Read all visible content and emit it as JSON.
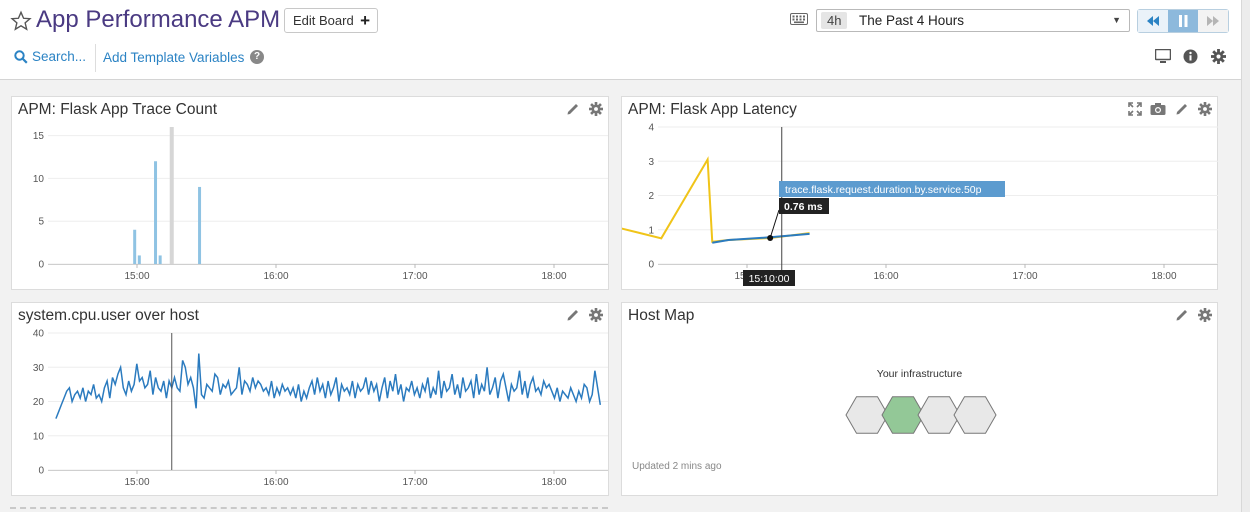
{
  "header": {
    "title": "App Performance APM",
    "edit_board_label": "Edit Board",
    "search_label": "Search...",
    "template_vars_label": "Add Template Variables",
    "time_badge": "4h",
    "time_range_label": "The Past 4 Hours"
  },
  "widgets": {
    "trace_count": {
      "title": "APM: Flask App Trace Count",
      "chart_data": {
        "type": "bar",
        "title": "APM: Flask App Trace Count",
        "x_ticks": [
          "15:00",
          "16:00",
          "17:00",
          "18:00"
        ],
        "y_ticks": [
          "0",
          "5",
          "10",
          "15"
        ],
        "ylim": [
          0,
          16
        ],
        "bar_color": "#8fc3e3",
        "bars": [
          {
            "t": "14:59",
            "value": 4
          },
          {
            "t": "15:01",
            "value": 1
          },
          {
            "t": "15:08",
            "value": 12
          },
          {
            "t": "15:10",
            "value": 1
          },
          {
            "t": "15:27",
            "value": 9
          }
        ],
        "cursor_time": "15:15"
      }
    },
    "latency": {
      "title": "APM: Flask App Latency",
      "tooltip_series": "trace.flask.request.duration.by.service.50p",
      "tooltip_value": "0.76 ms",
      "tooltip_time": "15:10:00",
      "chart_data": {
        "type": "line",
        "title": "APM: Flask App Latency",
        "x_ticks": [
          "15:00",
          "16:00",
          "17:00",
          "18:00"
        ],
        "y_ticks": [
          "0",
          "1",
          "2",
          "3",
          "4"
        ],
        "ylim": [
          0,
          4
        ],
        "series": [
          {
            "name": "trace.flask.request.duration.by.service.50p",
            "color": "#f0c419",
            "points": [
              [
                "14:05",
                1.05
              ],
              [
                "14:23",
                0.75
              ],
              [
                "14:43",
                3.05
              ],
              [
                "14:45",
                0.65
              ],
              [
                "14:52",
                0.7
              ],
              [
                "15:10",
                0.76
              ],
              [
                "15:27",
                0.9
              ]
            ]
          },
          {
            "color": "#2b7bbf",
            "points": [
              [
                "14:45",
                0.62
              ],
              [
                "14:52",
                0.7
              ],
              [
                "15:10",
                0.78
              ],
              [
                "15:27",
                0.88
              ]
            ]
          }
        ],
        "cursor_time": "15:15",
        "marker": {
          "t": "15:10",
          "value": 0.76
        }
      }
    },
    "cpu": {
      "title": "system.cpu.user over host",
      "chart_data": {
        "type": "line",
        "title": "system.cpu.user over host",
        "x_ticks": [
          "15:00",
          "16:00",
          "17:00",
          "18:00"
        ],
        "y_ticks": [
          "0",
          "10",
          "20",
          "30",
          "40"
        ],
        "ylim": [
          0,
          40
        ],
        "color": "#2b7bbf",
        "t_start": "14:25",
        "t_end": "18:20",
        "values": [
          15,
          17,
          19,
          21,
          23,
          24,
          20,
          22,
          23,
          21,
          24,
          20,
          23,
          22,
          25,
          21,
          22,
          20,
          24,
          26,
          21,
          27,
          25,
          28,
          30,
          24,
          22,
          26,
          23,
          25,
          31,
          26,
          27,
          24,
          25,
          29,
          22,
          27,
          24,
          23,
          26,
          21,
          26,
          24,
          27,
          24,
          23,
          32,
          30,
          25,
          27,
          24,
          18,
          34,
          22,
          21,
          25,
          24,
          23,
          28,
          27,
          22,
          25,
          24,
          26,
          22,
          23,
          24,
          30,
          22,
          26,
          25,
          23,
          27,
          24,
          26,
          25,
          23,
          24,
          22,
          26,
          21,
          24,
          22,
          25,
          23,
          24,
          22,
          24,
          21,
          25,
          20,
          23,
          21,
          24,
          26,
          22,
          27,
          23,
          25,
          21,
          26,
          22,
          24,
          27,
          20,
          25,
          23,
          24,
          22,
          26,
          21,
          25,
          23,
          24,
          27,
          22,
          26,
          23,
          25,
          20,
          24,
          27,
          21,
          26,
          23,
          28,
          22,
          25,
          20,
          24,
          23,
          26,
          22,
          24,
          21,
          25,
          23,
          27,
          21,
          24,
          22,
          29,
          21,
          26,
          23,
          24,
          28,
          22,
          25,
          21,
          27,
          23,
          24,
          26,
          21,
          28,
          22,
          25,
          23,
          30,
          22,
          24,
          27,
          21,
          26,
          28,
          24,
          20,
          25,
          23,
          24,
          29,
          22,
          26,
          21,
          25,
          27,
          23,
          24,
          22,
          26,
          24,
          25,
          23,
          21,
          24,
          20,
          23,
          22,
          21,
          24,
          22,
          20,
          23,
          21,
          25,
          24,
          20,
          22,
          29,
          24,
          19
        ]
      }
    },
    "host_map": {
      "title": "Host Map",
      "label": "Your infrastructure",
      "updated_text": "Updated 2 mins ago",
      "hex_fill": "#e8e8e8",
      "hex_highlight": "#93c897"
    }
  }
}
